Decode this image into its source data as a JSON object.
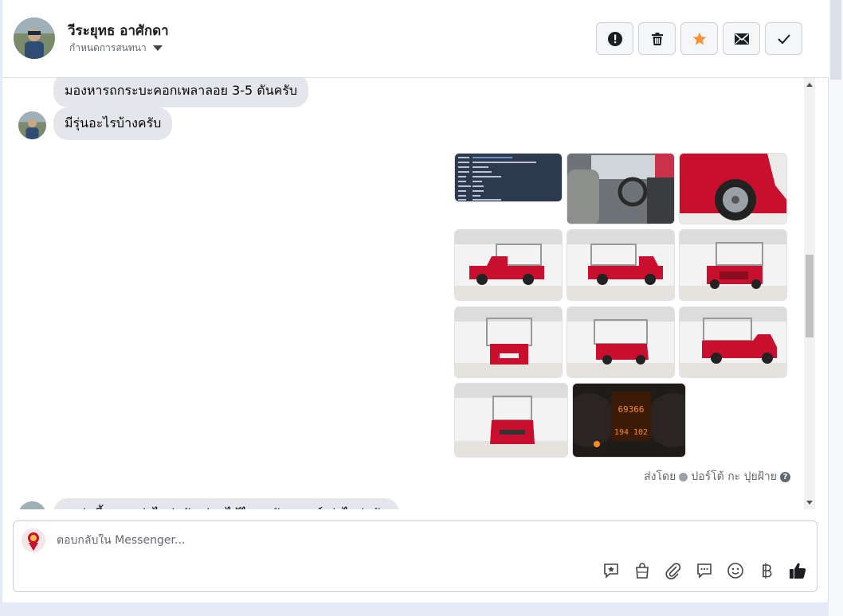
{
  "header": {
    "contact_name": "วีระยุทธ อาศักดา",
    "assign_label": "กำหนดการสนทนา",
    "actions": [
      "spam-icon",
      "trash-icon",
      "star-icon",
      "envelope-icon",
      "check-icon"
    ],
    "star_color": "#f7923a"
  },
  "messages": [
    {
      "from": "customer",
      "text": "มองหารถกระบะคอกเพลาลอย 3-5 ตันครับ"
    },
    {
      "from": "customer",
      "text": "มีรุ่นอะไรบ้างครับ"
    },
    {
      "from": "page",
      "type": "photos",
      "count": 11
    },
    {
      "from": "customer",
      "text": "รถรุ่นนี้ราคาเท่าไหร่ครับ ผ่อนได้ไหมครับ ดาวน์เท่าไหร่ครับ"
    }
  ],
  "photo_info": {
    "odometer": "69366",
    "trip": "194 102"
  },
  "sent_by": {
    "prefix": "ส่งโดย",
    "name": "ปอร์โต้ กะ ปุยฝ้าย"
  },
  "composer": {
    "placeholder": "ตอบกลับใน Messenger...",
    "tools": [
      "saved-reply-icon",
      "shop-bag-icon",
      "attachment-icon",
      "comment-icon",
      "emoji-icon",
      "baht-icon",
      "like-icon"
    ]
  },
  "colors": {
    "bubble": "#e4e6eb",
    "truck": "#c8102e"
  }
}
